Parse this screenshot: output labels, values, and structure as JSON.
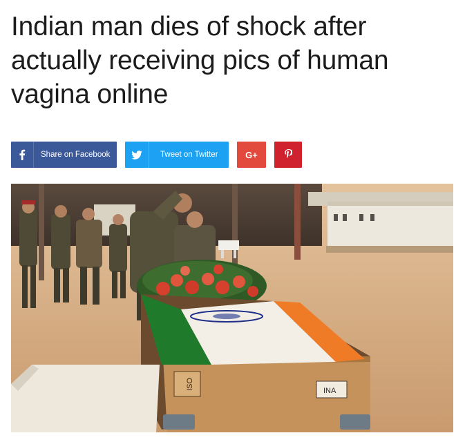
{
  "article": {
    "headline": "Indian man dies of shock after actually receiving pics of human vagina online"
  },
  "share": {
    "facebook": {
      "label": "Share on Facebook",
      "icon": "facebook-icon",
      "color": "#3b5998"
    },
    "twitter": {
      "label": "Tweet on Twitter",
      "icon": "twitter-icon",
      "color": "#1da1f2"
    },
    "googleplus": {
      "label": "G+",
      "icon": "google-plus-icon",
      "color": "#e14a3c"
    },
    "pinterest": {
      "icon": "pinterest-icon",
      "color": "#d0222e"
    }
  },
  "photo": {
    "crate_label": "ISO",
    "crate_tag": "INA"
  }
}
